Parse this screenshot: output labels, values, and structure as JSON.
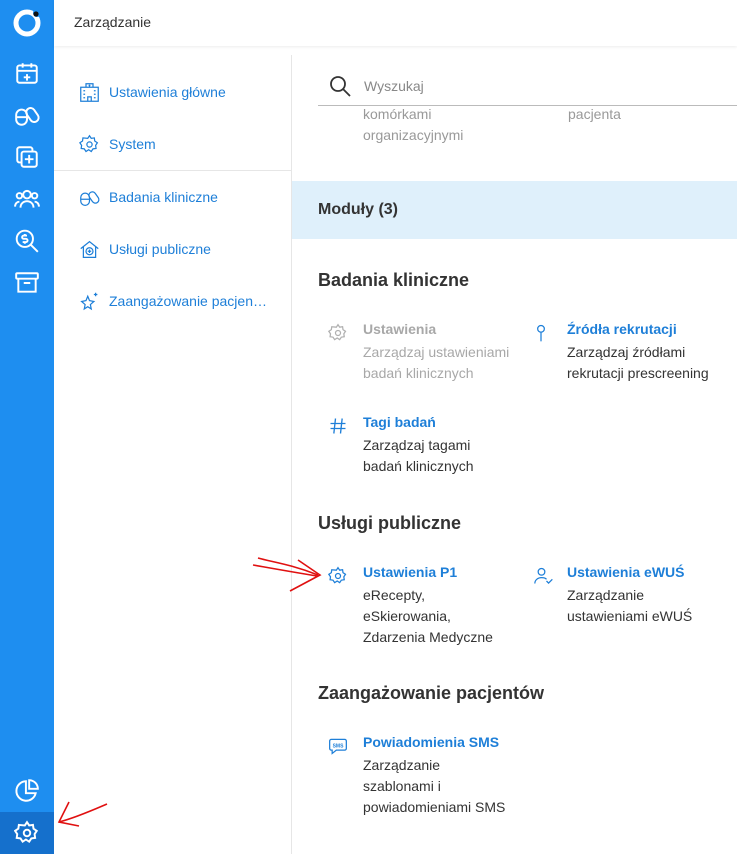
{
  "app": {
    "title": "Zarządzanie"
  },
  "rail": {
    "items": [
      {
        "icon": "calendar-add-icon"
      },
      {
        "icon": "pills-icon"
      },
      {
        "icon": "medical-plus-icon"
      },
      {
        "icon": "patients-icon"
      },
      {
        "icon": "money-search-icon"
      },
      {
        "icon": "archive-icon"
      },
      {
        "icon": "pie-chart-icon"
      },
      {
        "icon": "gear-icon"
      }
    ]
  },
  "sidebar": {
    "items": [
      {
        "label": "Ustawienia główne",
        "icon": "building-icon"
      },
      {
        "label": "System",
        "icon": "gear-icon"
      },
      {
        "label": "Badania kliniczne",
        "icon": "pills-icon"
      },
      {
        "label": "Usługi publiczne",
        "icon": "house-plus-icon"
      },
      {
        "label": "Zaangażowanie pacjentów",
        "icon": "sparkle-star-icon"
      }
    ]
  },
  "search": {
    "placeholder": "Wyszukaj",
    "value": ""
  },
  "clipped": {
    "left_line1": "komórkami",
    "left_line2": "organizacyjnymi",
    "right_line1": "pacjenta"
  },
  "modules": {
    "header": "Moduły (3)",
    "sections": [
      {
        "title": "Badania kliniczne",
        "cards": [
          {
            "title": "Ustawienia",
            "desc": "Zarządzaj ustawieniami badań klinicznych",
            "icon": "gear-icon",
            "disabled": true
          },
          {
            "title": "Źródła rekrutacji",
            "desc": "Zarządzaj źródłami rekrutacji prescreening",
            "icon": "pin-icon",
            "disabled": false
          },
          {
            "title": "Tagi badań",
            "desc": "Zarządzaj tagami badań klinicznych",
            "icon": "hashtag-icon",
            "disabled": false
          }
        ]
      },
      {
        "title": "Usługi publiczne",
        "cards": [
          {
            "title": "Ustawienia P1",
            "desc": "eRecepty, eSkierowania, Zdarzenia Medyczne",
            "icon": "gear-icon",
            "disabled": false
          },
          {
            "title": "Ustawienia eWUŚ",
            "desc": "Zarządzanie ustawieniami eWUŚ",
            "icon": "user-check-icon",
            "disabled": false
          }
        ]
      },
      {
        "title": "Zaangażowanie pacjentów",
        "cards": [
          {
            "title": "Powiadomienia SMS",
            "desc": "Zarządzanie szablonami i powiadomieniami SMS",
            "icon": "sms-bubble-icon",
            "disabled": false
          }
        ]
      }
    ]
  },
  "colors": {
    "rail": "#1e8ef0",
    "accent": "#1e7fd8",
    "module_header_bg": "#dff0fb",
    "annotation": "#e01010"
  }
}
